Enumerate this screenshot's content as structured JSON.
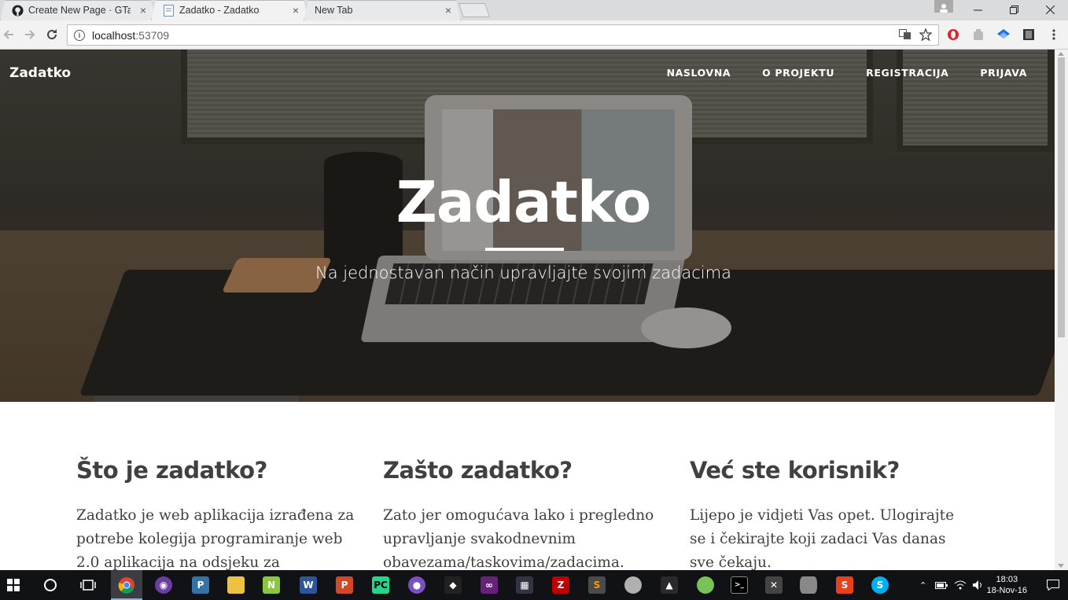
{
  "browser": {
    "tabs": [
      {
        "title": "Create New Page · GTade",
        "icon": "github-icon",
        "active": false
      },
      {
        "title": "Zadatko - Zadatko",
        "icon": "page-icon",
        "active": true
      },
      {
        "title": "New Tab",
        "icon": "",
        "active": false
      }
    ],
    "url_host": "localhost",
    "url_port": ":53709",
    "close_glyph": "×"
  },
  "site": {
    "brand": "Zadatko",
    "nav": [
      "NASLOVNA",
      "O PROJEKTU",
      "REGISTRACIJA",
      "PRIJAVA"
    ],
    "hero": {
      "title": "Zadatko",
      "subtitle": "Na jednostavan način upravljajte svojim zadacima"
    },
    "columns": [
      {
        "heading": "Što je zadatko?",
        "text": "Zadatko je web aplikacija izrađena za potrebe kolegija programiranje web 2.0 aplikacija na odsjeku za"
      },
      {
        "heading": "Zašto zadatko?",
        "text": "Zato jer omogućava lako i pregledno upravljanje svakodnevnim obavezama/taskovima/zadacima."
      },
      {
        "heading": "Već ste korisnik?",
        "text": "Lijepo je vidjeti Vas opet. Ulogirajte se i čekirajte koji zadaci Vas danas sve čekaju."
      }
    ]
  },
  "taskbar": {
    "time": "18:03",
    "date": "18-Nov-16",
    "apps": [
      "chrome-icon",
      "tor-icon",
      "python-icon",
      "file-explorer-icon",
      "notepad-plus-icon",
      "word-icon",
      "powerpoint-icon",
      "pycharm-icon",
      "eclipse-icon",
      "unity-icon",
      "visual-studio-icon",
      "video-editor-icon",
      "filezilla-icon",
      "sublime-icon",
      "paint-icon",
      "vpn-icon",
      "android-studio-icon",
      "cmd-icon",
      "tools-icon",
      "database-icon",
      "s-app-icon",
      "skype-icon"
    ]
  },
  "colors": {
    "heading": "#404040",
    "hero_text": "#ffffff",
    "taskbar": "#101216"
  }
}
